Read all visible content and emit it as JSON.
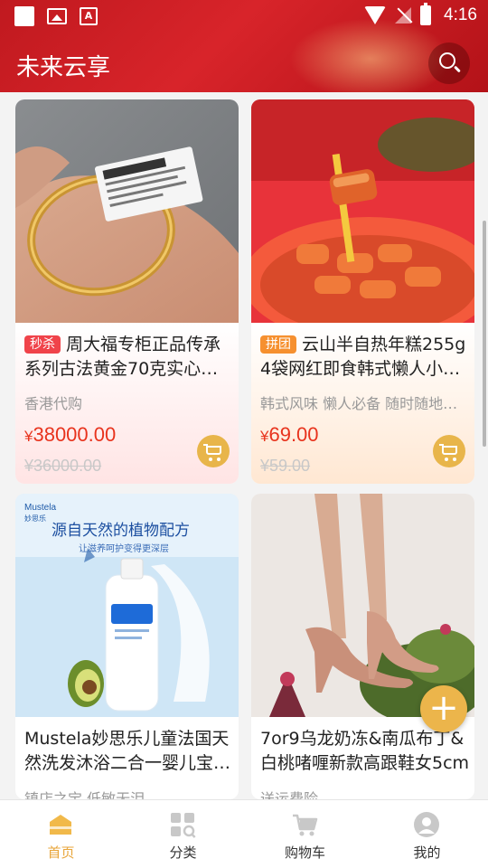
{
  "status_bar": {
    "time": "4:16",
    "notif_a": "A"
  },
  "header": {
    "title": "未来云享"
  },
  "products": [
    {
      "badge": "秒杀",
      "badge_color": "#f0434a",
      "title": "周大福专柜正品传承系列古法黄金70克实心…",
      "subtitle": "香港代购",
      "currency": "¥",
      "price": "38000.00",
      "original_price": "¥36000.00"
    },
    {
      "badge": "拼团",
      "badge_color": "#f6902f",
      "title": "云山半自热年糕255g 4袋网红即食韩式懒人小…",
      "subtitle": "韩式风味 懒人必备 随时随地…",
      "currency": "¥",
      "price": "69.00",
      "original_price": "¥59.00"
    },
    {
      "badge": "",
      "title": "Mustela妙思乐儿童法国天然洗发沐浴二合一婴儿宝…",
      "subtitle": "镇店之宝 低敏无泪"
    },
    {
      "badge": "",
      "title": "7or9乌龙奶冻&南瓜布丁&白桃啫喱新款高跟鞋女5cm",
      "subtitle": "送运费险"
    }
  ],
  "ad": {
    "brand": "Mustela",
    "brand_cn": "妙思乐",
    "headline": "源自天然的植物配方",
    "tagline": "让滋养呵护变得更深层"
  },
  "bottom_nav": [
    {
      "label": "首页",
      "active": true
    },
    {
      "label": "分类",
      "active": false
    },
    {
      "label": "购物车",
      "active": false
    },
    {
      "label": "我的",
      "active": false
    }
  ],
  "colors": {
    "header_red": "#c8191f",
    "accent_gold": "#e8b54a",
    "price_red": "#e8331d"
  }
}
